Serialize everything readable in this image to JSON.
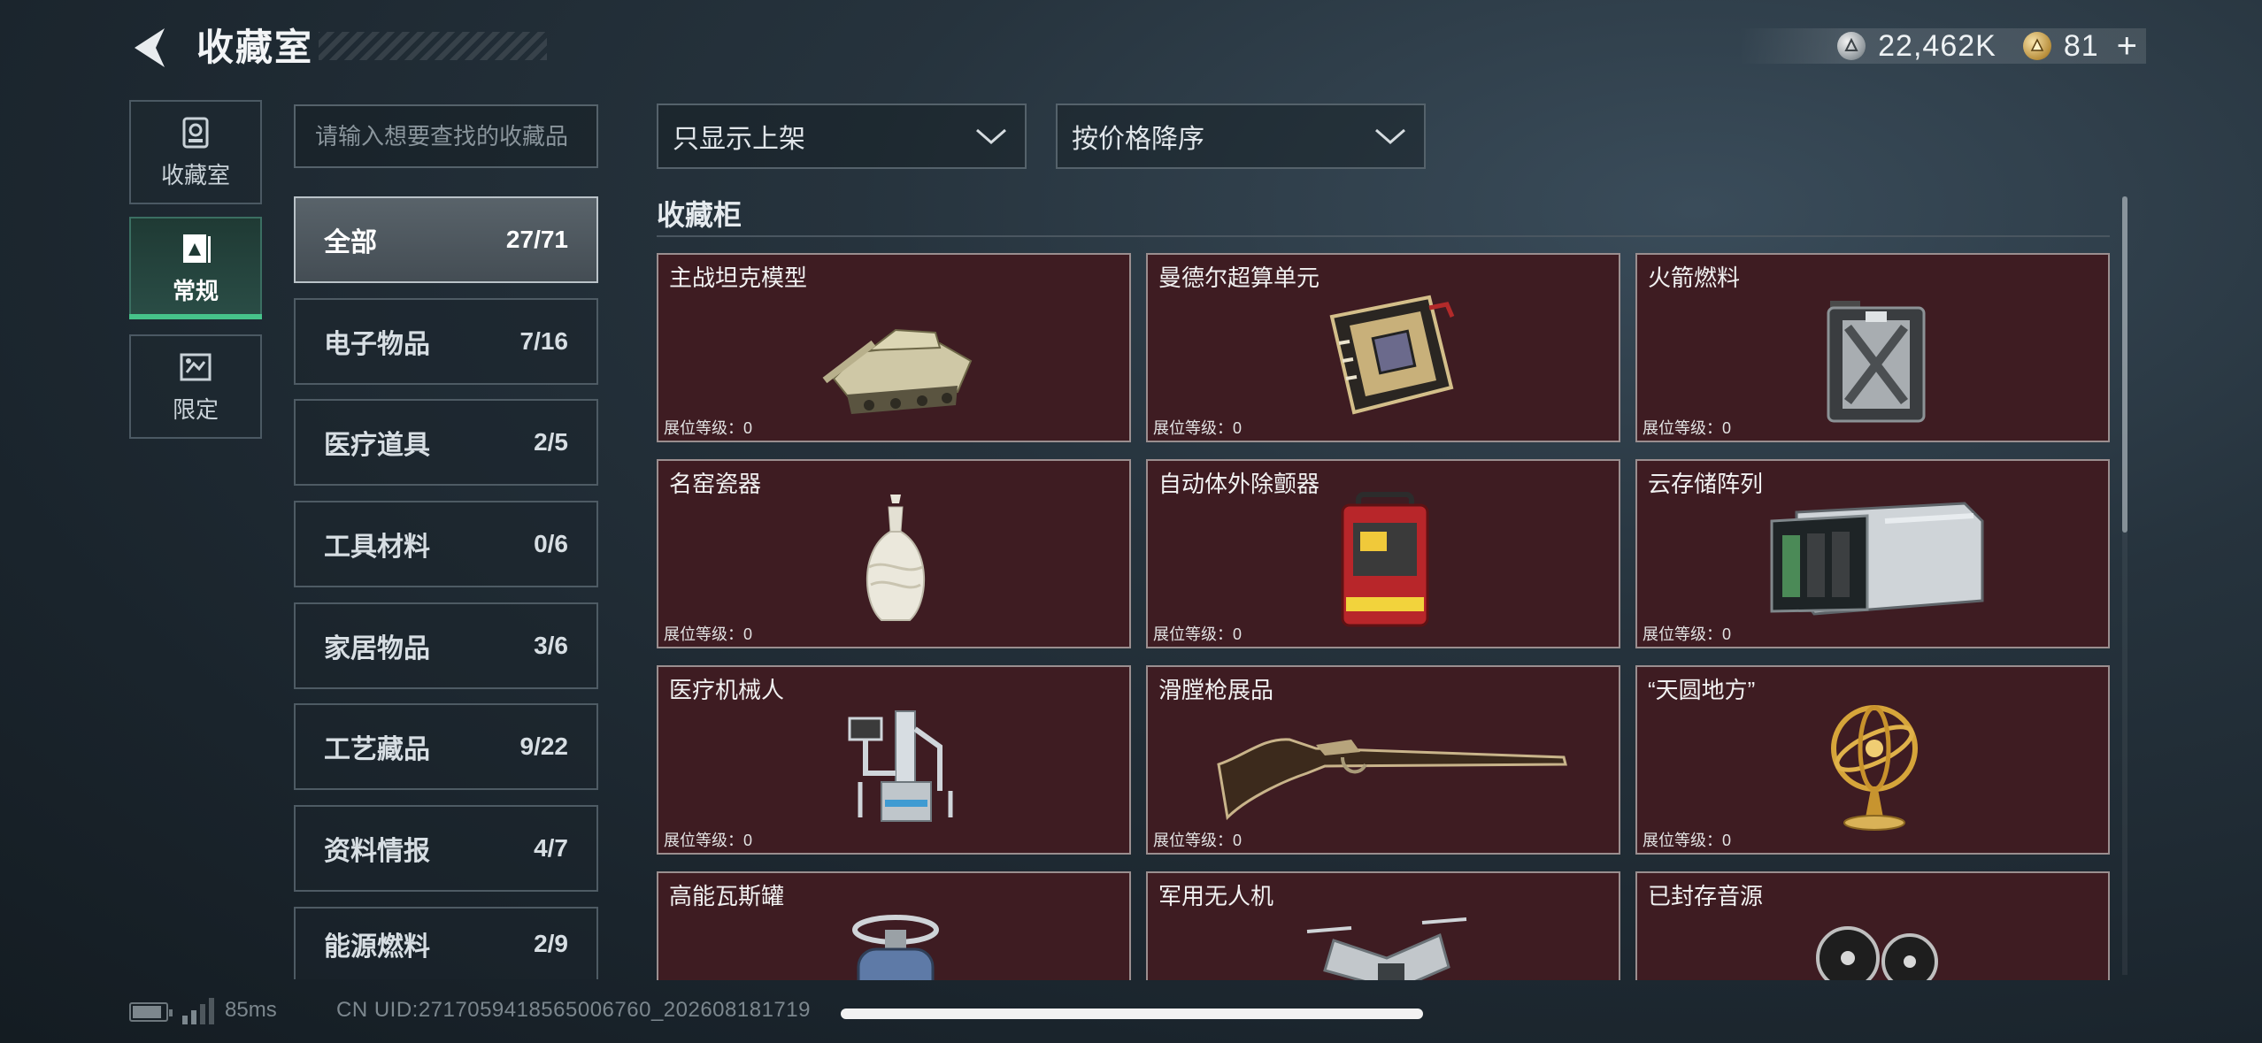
{
  "header": {
    "title": "收藏室",
    "currencies": [
      {
        "icon": "silver-coin-icon",
        "value": "22,462K"
      },
      {
        "icon": "gold-coin-icon",
        "value": "81"
      }
    ],
    "add_label": "+"
  },
  "rail": [
    {
      "label": "收藏室",
      "icon": "vault-icon",
      "active": false
    },
    {
      "label": "常规",
      "icon": "regular-collection-icon",
      "active": true
    },
    {
      "label": "限定",
      "icon": "limited-collection-icon",
      "active": false
    }
  ],
  "search": {
    "placeholder": "请输入想要查找的收藏品"
  },
  "categories": [
    {
      "name": "全部",
      "count": "27/71",
      "active": true
    },
    {
      "name": "电子物品",
      "count": "7/16"
    },
    {
      "name": "医疗道具",
      "count": "2/5"
    },
    {
      "name": "工具材料",
      "count": "0/6"
    },
    {
      "name": "家居物品",
      "count": "3/6"
    },
    {
      "name": "工艺藏品",
      "count": "9/22"
    },
    {
      "name": "资料情报",
      "count": "4/7"
    },
    {
      "name": "能源燃料",
      "count": "2/9"
    }
  ],
  "filters": {
    "display": "只显示上架",
    "sort": "按价格降序"
  },
  "section_title": "收藏柜",
  "items": [
    {
      "name": "主战坦克模型",
      "level": "展位等级：0",
      "icon": "tank-model-icon"
    },
    {
      "name": "曼德尔超算单元",
      "level": "展位等级：0",
      "icon": "supercomputer-unit-icon"
    },
    {
      "name": "火箭燃料",
      "level": "展位等级：0",
      "icon": "rocket-fuel-can-icon"
    },
    {
      "name": "名窑瓷器",
      "level": "展位等级：0",
      "icon": "porcelain-vase-icon"
    },
    {
      "name": "自动体外除颤器",
      "level": "展位等级：0",
      "icon": "defibrillator-icon"
    },
    {
      "name": "云存储阵列",
      "level": "展位等级：0",
      "icon": "cloud-storage-array-icon"
    },
    {
      "name": "医疗机械人",
      "level": "展位等级：0",
      "icon": "medical-robot-icon"
    },
    {
      "name": "滑膛枪展品",
      "level": "展位等级：0",
      "icon": "musket-icon"
    },
    {
      "name": "“天圆地方”",
      "level": "展位等级：0",
      "icon": "armillary-sphere-icon"
    },
    {
      "name": "高能瓦斯罐",
      "level": "",
      "icon": "gas-canister-icon"
    },
    {
      "name": "军用无人机",
      "level": "",
      "icon": "military-drone-icon"
    },
    {
      "name": "已封存音源",
      "level": "",
      "icon": "reel-recorder-icon"
    }
  ],
  "status_bar": {
    "ping": "85ms",
    "uid": "CN UID:27170594185650067​60_202608181719"
  },
  "colors": {
    "accent": "#46c38a",
    "card_bg": "#3e1c22",
    "card_border": "#9a8e8f"
  }
}
